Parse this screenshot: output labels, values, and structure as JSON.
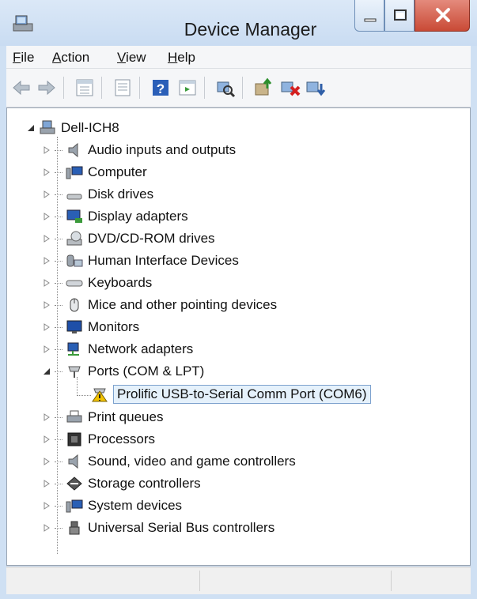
{
  "window": {
    "title": "Device Manager"
  },
  "menu": [
    {
      "label_underlined": "F",
      "label_rest": "ile"
    },
    {
      "label_underlined": "A",
      "label_rest": "ction"
    },
    {
      "label_underlined": "V",
      "label_rest": "iew"
    },
    {
      "label_underlined": "H",
      "label_rest": "elp"
    }
  ],
  "toolbar": [
    "back-icon",
    "forward-icon",
    "properties-grid-icon",
    "show-hide-icon",
    "help-icon",
    "action-view-icon",
    "scan-hardware-icon",
    "update-driver-icon",
    "uninstall-icon",
    "rollback-icon"
  ],
  "tree": {
    "root": "Dell-ICH8",
    "categories": [
      {
        "label": "Audio inputs and outputs",
        "icon": "speaker-icon"
      },
      {
        "label": "Computer",
        "icon": "computer-icon"
      },
      {
        "label": "Disk drives",
        "icon": "disk-drive-icon"
      },
      {
        "label": "Display adapters",
        "icon": "display-adapter-icon"
      },
      {
        "label": "DVD/CD-ROM drives",
        "icon": "dvd-drive-icon"
      },
      {
        "label": "Human Interface Devices",
        "icon": "hid-icon"
      },
      {
        "label": "Keyboards",
        "icon": "keyboard-icon"
      },
      {
        "label": "Mice and other pointing devices",
        "icon": "mouse-icon"
      },
      {
        "label": "Monitors",
        "icon": "monitor-icon"
      },
      {
        "label": "Network adapters",
        "icon": "network-icon"
      },
      {
        "label": "Ports (COM & LPT)",
        "icon": "port-icon"
      },
      {
        "label": "Print queues",
        "icon": "printer-icon"
      },
      {
        "label": "Processors",
        "icon": "processor-icon"
      },
      {
        "label": "Sound, video and game controllers",
        "icon": "sound-icon"
      },
      {
        "label": "Storage controllers",
        "icon": "storage-icon"
      },
      {
        "label": "System devices",
        "icon": "system-icon"
      },
      {
        "label": "Universal Serial Bus controllers",
        "icon": "usb-icon"
      }
    ],
    "ports_child": {
      "label": "Prolific USB-to-Serial Comm Port (COM6)",
      "icon": "warning-port-icon"
    }
  },
  "colors": {
    "selection_bg": "#e5f1fb",
    "selection_border": "#7da2ce",
    "close_button": "#c94a36",
    "warning": "#f2c200"
  }
}
